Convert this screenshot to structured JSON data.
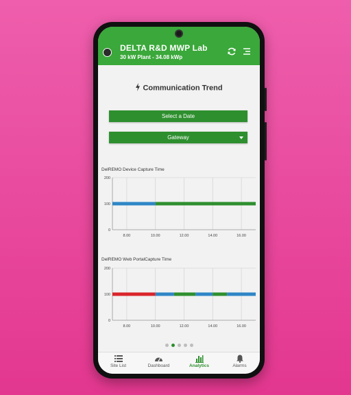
{
  "header": {
    "site_name": "DELTA R&D MWP Lab",
    "plant_info": "30 kW Plant - 34.08 kWp"
  },
  "page": {
    "title": "Communication Trend"
  },
  "controls": {
    "date_button": "Select a Date",
    "gateway_select": "Gateway"
  },
  "chart_data": [
    {
      "type": "line",
      "title": "DelREMO  Device Capture Time",
      "y_ticks": [
        "200",
        "100",
        "0"
      ],
      "x_ticks": [
        "8.00",
        "10.00",
        "12.00",
        "14.00",
        "16.00"
      ],
      "ylim": [
        0,
        200
      ],
      "xlim": [
        7,
        17
      ],
      "grid": true,
      "series_value": 100,
      "segments": [
        {
          "from": 7.0,
          "to": 10.0,
          "color": "#2f86c6"
        },
        {
          "from": 10.0,
          "to": 17.0,
          "color": "#2e8f2e"
        }
      ]
    },
    {
      "type": "line",
      "title": "DelREMO  Web PortalCapture Time",
      "y_ticks": [
        "200",
        "100",
        "0"
      ],
      "x_ticks": [
        "8.00",
        "10.00",
        "12.00",
        "14.00",
        "16.00"
      ],
      "ylim": [
        0,
        200
      ],
      "xlim": [
        7,
        17
      ],
      "grid": true,
      "series_value": 100,
      "segments": [
        {
          "from": 7.0,
          "to": 10.0,
          "color": "#d9252b"
        },
        {
          "from": 10.0,
          "to": 11.3,
          "color": "#2f86c6"
        },
        {
          "from": 11.3,
          "to": 12.8,
          "color": "#2e8f2e"
        },
        {
          "from": 12.8,
          "to": 14.0,
          "color": "#2f86c6"
        },
        {
          "from": 14.0,
          "to": 15.0,
          "color": "#2e8f2e"
        },
        {
          "from": 15.0,
          "to": 17.0,
          "color": "#2f86c6"
        }
      ]
    }
  ],
  "pager": {
    "count": 5,
    "active": 1
  },
  "nav": {
    "items": [
      {
        "label": "Site List",
        "icon": "list-icon"
      },
      {
        "label": "Dashboard",
        "icon": "gauge-icon"
      },
      {
        "label": "Analytics",
        "icon": "bar-chart-icon"
      },
      {
        "label": "Alarms",
        "icon": "bell-icon"
      }
    ],
    "active_index": 2
  },
  "colors": {
    "primary_green": "#3aa83a",
    "dark_green": "#2e8f2e",
    "blue": "#2f86c6",
    "red": "#d9252b",
    "background": "#e8449c"
  }
}
